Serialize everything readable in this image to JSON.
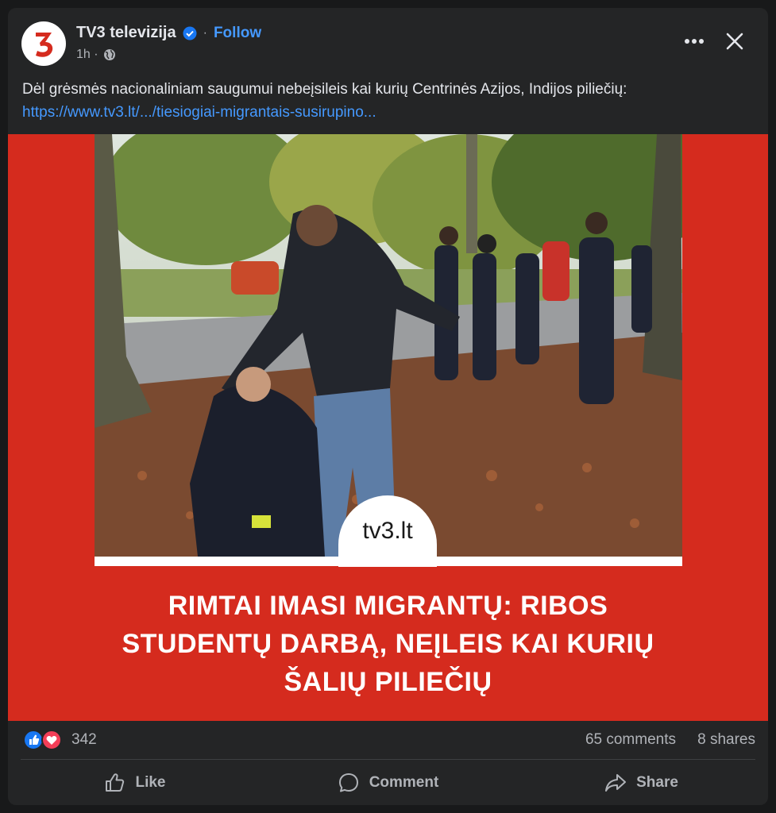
{
  "header": {
    "page_name": "TV3 televizija",
    "separator": "·",
    "follow_label": "Follow",
    "time": "1h ·"
  },
  "post": {
    "text": "Dėl grėsmės nacionaliniam saugumui nebeįsileis kai kurių Centrinės Azijos, Indijos piliečių:",
    "link": "https://www.tv3.lt/.../tiesiogiai-migrantais-susirupino..."
  },
  "image": {
    "watermark": "tv3.lt",
    "headline_lines": [
      "RIMTAI IMASI MIGRANTŲ: RIBOS",
      "STUDENTŲ DARBĄ, NEĮLEIS KAI KURIŲ",
      "ŠALIŲ PILIEČIŲ"
    ]
  },
  "stats": {
    "reactions_count": "342",
    "comments": "65 comments",
    "shares": "8 shares"
  },
  "actions": {
    "like": "Like",
    "comment": "Comment",
    "share": "Share"
  },
  "colors": {
    "background": "#18191a",
    "card": "#242526",
    "accent_link": "#4599ff",
    "image_red": "#d52b1e",
    "like_blue": "#1877f2",
    "love_red": "#f33e58"
  },
  "icons": [
    "tv3-logo-icon",
    "verified-badge-icon",
    "globe-icon",
    "more-options-icon",
    "close-icon",
    "like-reaction-icon",
    "love-reaction-icon",
    "thumbs-up-icon",
    "comment-bubble-icon",
    "share-arrow-icon"
  ]
}
